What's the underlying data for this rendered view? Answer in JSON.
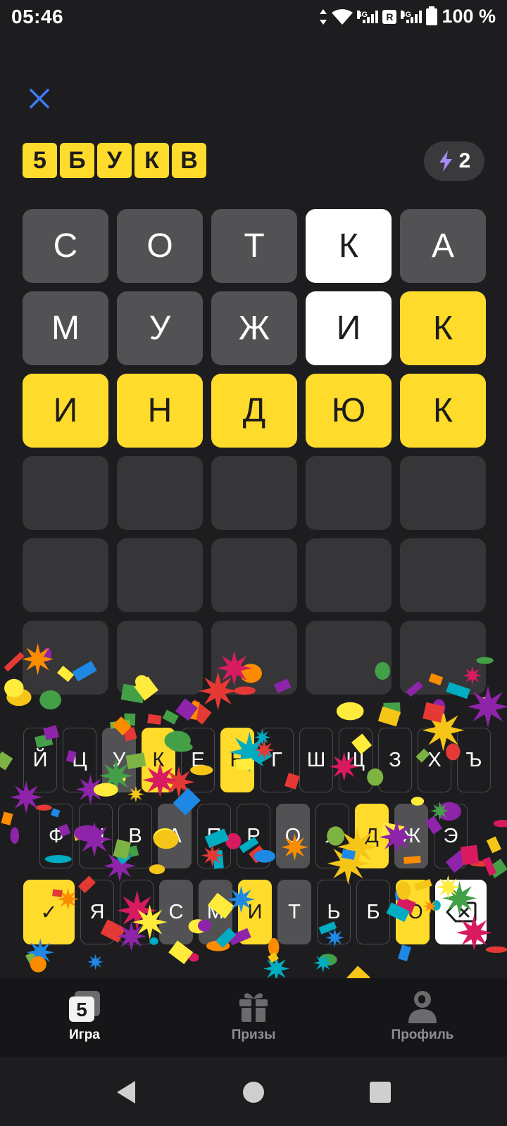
{
  "status_bar": {
    "time": "05:46",
    "network_left": "4G",
    "roaming": "R",
    "network_right": "4G",
    "battery": "100 %"
  },
  "header": {
    "close_icon": "close-icon",
    "logo_letters": [
      "5",
      "Б",
      "У",
      "К",
      "В"
    ],
    "energy_count": "2",
    "energy_icon": "lightning-icon"
  },
  "board": {
    "rows": [
      [
        {
          "letter": "С",
          "state": "absent"
        },
        {
          "letter": "О",
          "state": "absent"
        },
        {
          "letter": "Т",
          "state": "absent"
        },
        {
          "letter": "К",
          "state": "present"
        },
        {
          "letter": "А",
          "state": "absent"
        }
      ],
      [
        {
          "letter": "М",
          "state": "absent"
        },
        {
          "letter": "У",
          "state": "absent"
        },
        {
          "letter": "Ж",
          "state": "absent"
        },
        {
          "letter": "И",
          "state": "present"
        },
        {
          "letter": "К",
          "state": "correct"
        }
      ],
      [
        {
          "letter": "И",
          "state": "correct"
        },
        {
          "letter": "Н",
          "state": "correct"
        },
        {
          "letter": "Д",
          "state": "correct"
        },
        {
          "letter": "Ю",
          "state": "correct"
        },
        {
          "letter": "К",
          "state": "correct"
        }
      ],
      [
        {
          "letter": "",
          "state": "empty"
        },
        {
          "letter": "",
          "state": "empty"
        },
        {
          "letter": "",
          "state": "empty"
        },
        {
          "letter": "",
          "state": "empty"
        },
        {
          "letter": "",
          "state": "empty"
        }
      ],
      [
        {
          "letter": "",
          "state": "empty"
        },
        {
          "letter": "",
          "state": "empty"
        },
        {
          "letter": "",
          "state": "empty"
        },
        {
          "letter": "",
          "state": "empty"
        },
        {
          "letter": "",
          "state": "empty"
        }
      ],
      [
        {
          "letter": "",
          "state": "empty"
        },
        {
          "letter": "",
          "state": "empty"
        },
        {
          "letter": "",
          "state": "empty"
        },
        {
          "letter": "",
          "state": "empty"
        },
        {
          "letter": "",
          "state": "empty"
        }
      ]
    ]
  },
  "keyboard": {
    "row1": [
      {
        "label": "Й",
        "state": "unused"
      },
      {
        "label": "Ц",
        "state": "unused"
      },
      {
        "label": "У",
        "state": "absent"
      },
      {
        "label": "К",
        "state": "correct"
      },
      {
        "label": "Е",
        "state": "unused"
      },
      {
        "label": "Н",
        "state": "correct"
      },
      {
        "label": "Г",
        "state": "unused"
      },
      {
        "label": "Ш",
        "state": "unused"
      },
      {
        "label": "Щ",
        "state": "unused"
      },
      {
        "label": "З",
        "state": "unused"
      },
      {
        "label": "Х",
        "state": "unused"
      },
      {
        "label": "Ъ",
        "state": "unused"
      }
    ],
    "row2": [
      {
        "label": "Ф",
        "state": "unused"
      },
      {
        "label": "Ы",
        "state": "unused"
      },
      {
        "label": "В",
        "state": "unused"
      },
      {
        "label": "А",
        "state": "absent"
      },
      {
        "label": "П",
        "state": "unused"
      },
      {
        "label": "Р",
        "state": "unused"
      },
      {
        "label": "О",
        "state": "absent"
      },
      {
        "label": "Л",
        "state": "unused"
      },
      {
        "label": "Д",
        "state": "correct"
      },
      {
        "label": "Ж",
        "state": "absent"
      },
      {
        "label": "Э",
        "state": "unused"
      }
    ],
    "row3": [
      {
        "label": "✓",
        "state": "correct",
        "wide": true,
        "name": "submit-key"
      },
      {
        "label": "Я",
        "state": "unused"
      },
      {
        "label": "Ч",
        "state": "unused"
      },
      {
        "label": "С",
        "state": "absent"
      },
      {
        "label": "М",
        "state": "absent"
      },
      {
        "label": "И",
        "state": "correct"
      },
      {
        "label": "Т",
        "state": "absent"
      },
      {
        "label": "Ь",
        "state": "unused"
      },
      {
        "label": "Б",
        "state": "unused"
      },
      {
        "label": "Ю",
        "state": "correct"
      },
      {
        "label": "",
        "state": "present",
        "wide": true,
        "name": "backspace-key",
        "icon": "backspace-icon"
      }
    ]
  },
  "tabs": [
    {
      "label": "Игра",
      "icon": "game-icon",
      "active": true
    },
    {
      "label": "Призы",
      "icon": "gift-icon",
      "active": false
    },
    {
      "label": "Профиль",
      "icon": "profile-icon",
      "active": false
    }
  ],
  "nav": {
    "back_icon": "back-triangle-icon",
    "home_icon": "home-circle-icon",
    "recents_icon": "recents-square-icon"
  },
  "colors": {
    "background": "#1d1d1f",
    "correct": "#ffdb2c",
    "present": "#ffffff",
    "absent": "#525254",
    "empty": "#363638",
    "accent_close": "#3d7bf4"
  }
}
